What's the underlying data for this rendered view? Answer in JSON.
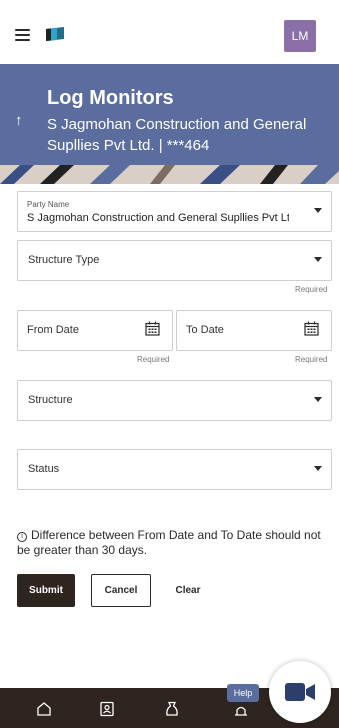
{
  "app": {
    "avatar_initials": "LM"
  },
  "header": {
    "title": "Log Monitors",
    "subtitle": "S Jagmohan Construction and General Supllies Pvt Ltd. | ***464"
  },
  "form": {
    "party_name": {
      "label": "Party Name",
      "value": "S Jagmohan Construction and General Supllies Pvt Ltd."
    },
    "structure_type": {
      "label": "Structure Type",
      "required": "Required"
    },
    "from_date": {
      "label": "From Date",
      "required": "Required"
    },
    "to_date": {
      "label": "To Date",
      "required": "Required"
    },
    "structure": {
      "label": "Structure"
    },
    "status": {
      "label": "Status"
    }
  },
  "note": {
    "info_glyph": "i",
    "text": "Difference between From Date and To Date should not be greater than 30 days."
  },
  "buttons": {
    "submit": "Submit",
    "cancel": "Cancel",
    "clear": "Clear"
  },
  "help": {
    "label": "Help"
  },
  "colors": {
    "header_bg": "#5a6d9e",
    "primary_dark": "#2e2420",
    "avatar_bg": "#8a6fa8"
  },
  "icons": [
    "hamburger-icon",
    "bank-logo-icon",
    "back-arrow-icon",
    "chevron-down-icon",
    "calendar-icon",
    "info-icon",
    "home-icon",
    "contacts-icon",
    "offers-icon",
    "help-icon",
    "video-call-icon"
  ]
}
